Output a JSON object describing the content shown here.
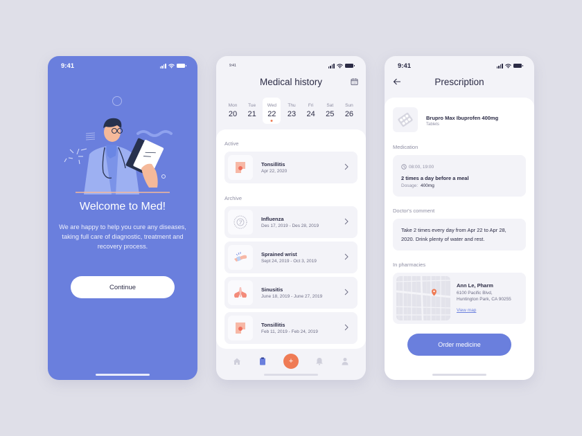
{
  "colors": {
    "background": "#dfdfe8",
    "primary": "#6a7fdd",
    "accent": "#ef7b55",
    "surface": "#f3f3f8"
  },
  "welcome_screen": {
    "status_time": "9:41",
    "title": "Welcome to Med!",
    "description": "We are happy to help you cure any diseases, taking full care of diagnostic, treatment and recovery process.",
    "continue_label": "Continue"
  },
  "history_screen": {
    "status_time": "9:41",
    "title": "Medical history",
    "calendar_icon": "calendar-icon",
    "week": [
      {
        "name": "Mon",
        "num": "20"
      },
      {
        "name": "Tue",
        "num": "21"
      },
      {
        "name": "Wed",
        "num": "22",
        "selected": true
      },
      {
        "name": "Thu",
        "num": "23"
      },
      {
        "name": "Fri",
        "num": "24"
      },
      {
        "name": "Sat",
        "num": "25"
      },
      {
        "name": "Sun",
        "num": "26"
      }
    ],
    "active_label": "Active",
    "archive_label": "Archive",
    "active": [
      {
        "title": "Tonsillitis",
        "date": "Apr 22, 2020",
        "icon": "throat-icon"
      }
    ],
    "archive": [
      {
        "title": "Influenza",
        "date": "Des 17, 2019 - Des 28, 2019",
        "icon": "virus-icon"
      },
      {
        "title": "Sprained wrist",
        "date": "Sept 24, 2019 - Oct 3, 2019",
        "icon": "wrist-icon"
      },
      {
        "title": "Sinusitis",
        "date": "June 18, 2019 - June 27, 2019",
        "icon": "sinus-icon"
      },
      {
        "title": "Tonsillitis",
        "date": "Feb 11, 2019 - Feb 24, 2019",
        "icon": "throat-icon"
      }
    ],
    "tabbar": {
      "items": [
        "home-icon",
        "clipboard-icon",
        "add-icon",
        "bell-icon",
        "user-icon"
      ],
      "active": "clipboard-icon",
      "fab_label": "+"
    }
  },
  "prescription_screen": {
    "status_time": "9:41",
    "title": "Prescription",
    "drug": {
      "name": "Brupro Max Ibuprofen 400mg",
      "form": "Tablets"
    },
    "medication_label": "Medication",
    "medication": {
      "times": "08:00, 19:00",
      "frequency": "2 times a day before a meal",
      "dosage_label": "Dosage:",
      "dosage_value": "400mg"
    },
    "comment_label": "Doctor's comment",
    "comment": "Take 2 times every day from Apr 22 to Apr 28, 2020. Drink plenty of water and rest.",
    "pharmacies_label": "In pharmacies",
    "pharmacy": {
      "name": "Ann Le, Pharm",
      "address_line1": "6100 Pacific Blvd,",
      "address_line2": "Huntington Park, CA 90255",
      "link": "View map"
    },
    "order_label": "Order medicine"
  }
}
